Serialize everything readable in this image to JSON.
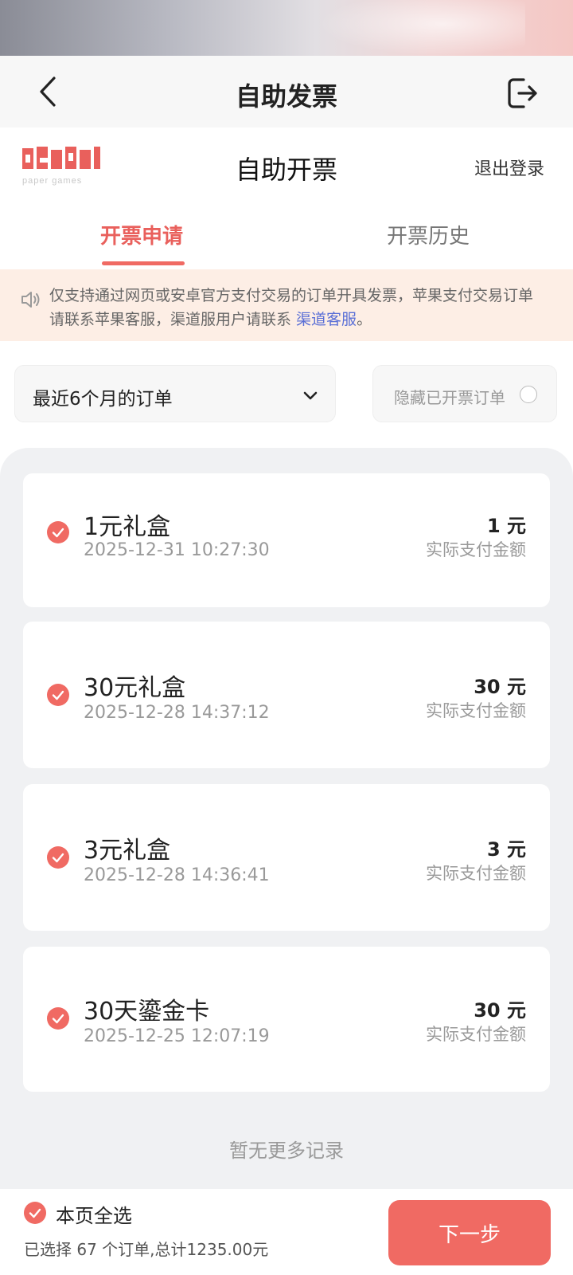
{
  "navbar": {
    "title": "自助发票"
  },
  "header": {
    "title": "自助开票",
    "logout_label": "退出登录",
    "logo_text": "paper games"
  },
  "tabs": [
    {
      "label": "开票申请",
      "active": true
    },
    {
      "label": "开票历史",
      "active": false
    }
  ],
  "notice": {
    "text": "仅支持通过网页或安卓官方支付交易的订单开具发票，苹果支付交易订单请联系苹果客服，渠道服用户请联系 ",
    "link_label": "渠道客服",
    "suffix": "。"
  },
  "filter": {
    "selected": "最近6个月的订单"
  },
  "hide_toggle": {
    "label": "隐藏已开票订单",
    "checked": false
  },
  "orders": [
    {
      "name": "1元礼盒",
      "date": "2025-12-31 10:27:30",
      "amount": "1 元",
      "amount_label": "实际支付金额",
      "checked": true
    },
    {
      "name": "30元礼盒",
      "date": "2025-12-28 14:37:12",
      "amount": "30 元",
      "amount_label": "实际支付金额",
      "checked": true
    },
    {
      "name": "3元礼盒",
      "date": "2025-12-28 14:36:41",
      "amount": "3 元",
      "amount_label": "实际支付金额",
      "checked": true
    },
    {
      "name": "30天鎏金卡",
      "date": "2025-12-25 12:07:19",
      "amount": "30 元",
      "amount_label": "实际支付金额",
      "checked": true
    }
  ],
  "no_more": "暂无更多记录",
  "footer": {
    "select_all_label": "本页全选",
    "summary": "已选择 67 个订单,总计1235.00元",
    "next_label": "下一步"
  },
  "colors": {
    "accent": "#f06a63",
    "link": "#5a6fd6",
    "notice_bg": "#fdeee5"
  }
}
